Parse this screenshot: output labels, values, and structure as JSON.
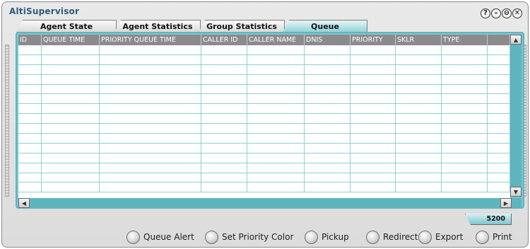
{
  "window": {
    "title": "AltiSupervisor",
    "controls": [
      "?",
      "–",
      "⊖",
      "✕"
    ]
  },
  "tabs": [
    {
      "label": "Agent State",
      "active": false
    },
    {
      "label": "Agent Statistics",
      "active": false
    },
    {
      "label": "Group Statistics",
      "active": false
    },
    {
      "label": "Queue",
      "active": true
    }
  ],
  "grid": {
    "columns": [
      "ID",
      "QUEUE TIME",
      "PRIORITY QUEUE TIME",
      "CALLER ID",
      "CALLER NAME",
      "DNIS",
      "PRIORITY",
      "SKLR",
      "TYPE",
      ""
    ],
    "rows": 15
  },
  "status": {
    "queue_count": "5200"
  },
  "actions": [
    {
      "label": "Queue Alert"
    },
    {
      "label": "Set Priority Color"
    },
    {
      "label": "Pickup"
    },
    {
      "label": "Redirect"
    },
    {
      "label": "Export"
    },
    {
      "label": "Print"
    }
  ],
  "colors": {
    "accent": "#7cc7cf",
    "header": "#8b8b8b",
    "title": "#2e5c7a"
  }
}
